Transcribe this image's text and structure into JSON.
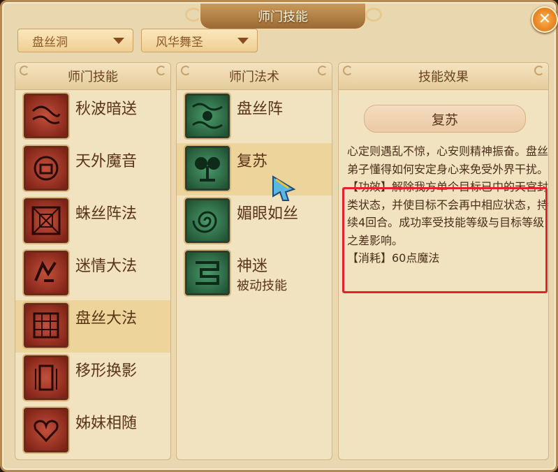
{
  "window": {
    "title": "师门技能"
  },
  "filters": {
    "sect": "盘丝洞",
    "role": "风华舞圣"
  },
  "panels": {
    "skills_header": "师门技能",
    "spells_header": "师门法术",
    "effect_header": "技能效果"
  },
  "skills": [
    {
      "name": "秋波暗送",
      "icon": "wave-eye-icon"
    },
    {
      "name": "天外魔音",
      "icon": "bell-icon"
    },
    {
      "name": "蛛丝阵法",
      "icon": "web-square-icon"
    },
    {
      "name": "迷情大法",
      "icon": "bird-icon"
    },
    {
      "name": "盘丝大法",
      "icon": "lattice-icon",
      "selected": true
    },
    {
      "name": "移形换影",
      "icon": "figure-icon"
    },
    {
      "name": "姊妹相随",
      "icon": "heart-icon"
    }
  ],
  "spells": [
    {
      "name": "盘丝阵",
      "sub": "",
      "icon": "web-formation-icon"
    },
    {
      "name": "复苏",
      "sub": "",
      "icon": "tree-icon",
      "selected": true
    },
    {
      "name": "媚眼如丝",
      "sub": "",
      "icon": "spiral-icon"
    },
    {
      "name": "神迷",
      "sub": "被动技能",
      "icon": "maze-icon"
    }
  ],
  "effect": {
    "title": "复苏",
    "intro": "心定则遇乱不惊，心安则精神振奋。盘丝弟子懂得如何安定身心来免受外界干扰。",
    "efficacy": "【功效】解除我方单个目标已中的天宫封类状态，并使目标不会再中相应状态，持续4回合。成功率受技能等级与目标等级之差影响。",
    "cost": "【消耗】60点魔法"
  },
  "colors": {
    "highlight": "#e8202a",
    "selected_row": "#ecd49a"
  }
}
